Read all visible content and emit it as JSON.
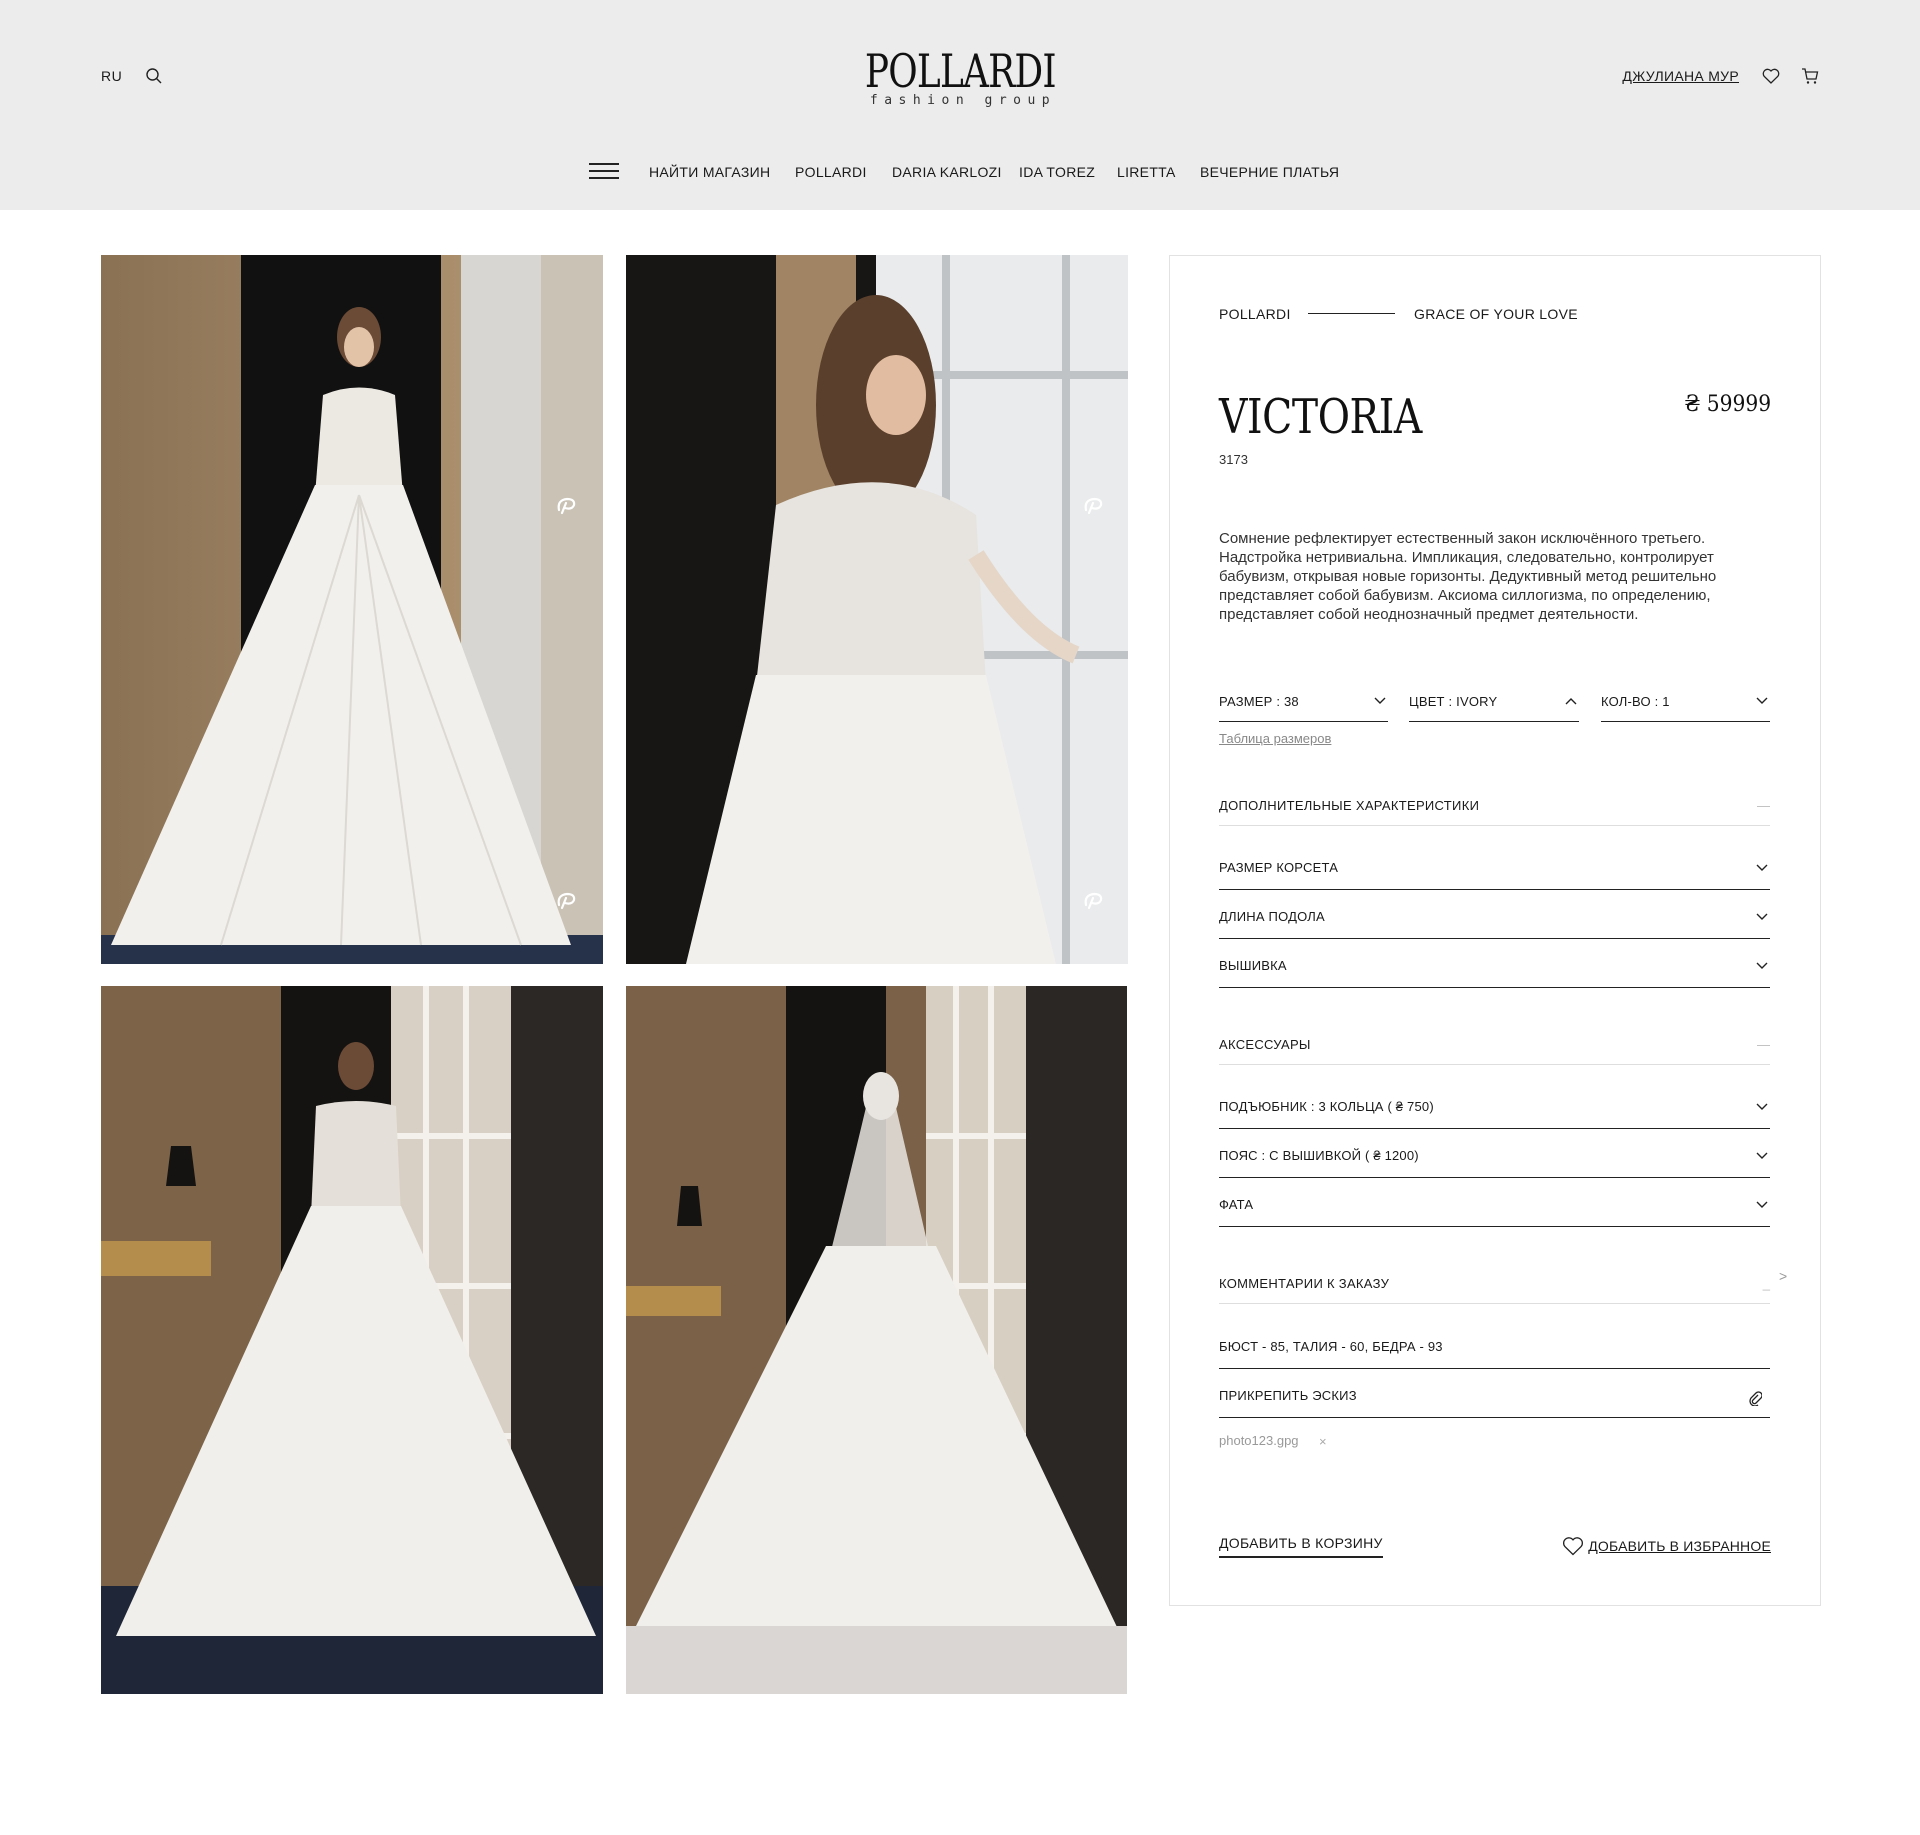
{
  "header": {
    "lang": "RU",
    "logo_main": "POLLARDI",
    "logo_sub": "fashion group",
    "user_name": "ДЖУЛИАНА МУР",
    "nav": [
      "НАЙТИ МАГАЗИН",
      "POLLARDI",
      "DARIA KARLOZI",
      "IDA TOREZ",
      "LIRETTA",
      "ВЕЧЕРНИЕ ПЛАТЬЯ"
    ]
  },
  "breadcrumb": {
    "brand": "POLLARDI",
    "collection": "GRACE OF YOUR LOVE"
  },
  "product": {
    "title": "VICTORIA",
    "price": "₴ 59999",
    "sku": "3173",
    "description": "Сомнение рефлектирует естественный закон исключённого третьего. Надстройка нетривиальна. Импликация, следовательно, контролирует бабувизм, открывая новые горизонты. Дедуктивный метод решительно представляет собой бабувизм. Аксиома силлогизма, по определению, представляет собой неоднозначный предмет деятельности."
  },
  "selectors": {
    "size": "РАЗМЕР :  38",
    "color": "ЦВЕТ :  IVORY",
    "qty": "КОЛ-ВО :  1",
    "size_table": "Таблица размеров"
  },
  "extra": {
    "heading": "ДОПОЛНИТЕЛЬНЫЕ ХАРАКТЕРИСТИКИ",
    "collapse": "—",
    "items": [
      "РАЗМЕР КОРСЕТА",
      "ДЛИНА ПОДОЛА",
      "ВЫШИВКА"
    ]
  },
  "accessories": {
    "heading": "АКСЕССУАРЫ",
    "collapse": "—",
    "items": [
      "ПОДЪЮБНИК :   3 КОЛЬЦА ( ₴ 750)",
      "ПОЯС : С ВЫШИВКОЙ ( ₴ 1200)",
      "ФАТА"
    ]
  },
  "comments": {
    "heading": "КОММЕНТАРИИ К ЗАКАЗУ",
    "collapse": "_",
    "side_arrow": ">",
    "value": "БЮСТ - 85, ТАЛИЯ - 60, БЕДРА - 93",
    "attach": "ПРИКРЕПИТЬ ЭСКИЗ",
    "file": "photo123.gpg",
    "file_remove": "×"
  },
  "actions": {
    "add_cart": "ДОБАВИТЬ В КОРЗИНУ",
    "add_fav": "ДОБАВИТЬ В ИЗБРАННОЕ"
  },
  "colors": {
    "header_bg": "#ececec",
    "text": "#1a1a1a",
    "muted": "#888888"
  }
}
